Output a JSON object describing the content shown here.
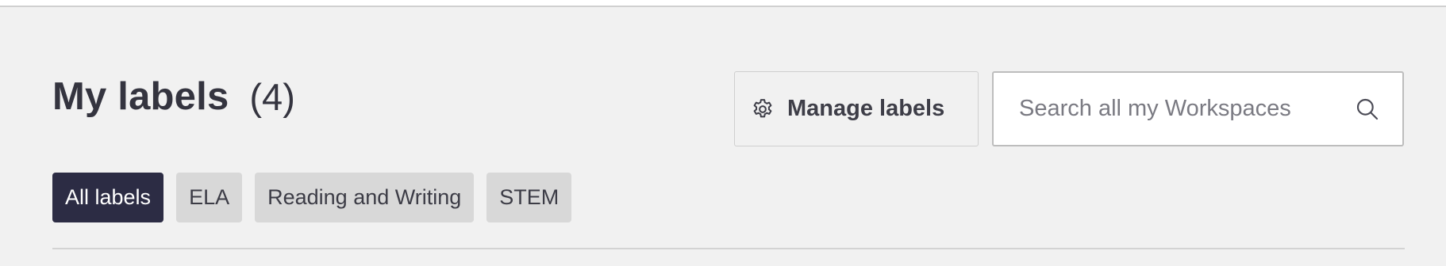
{
  "header": {
    "title": "My labels",
    "count": "(4)"
  },
  "toolbar": {
    "manage_label": "Manage labels",
    "manage_icon": "gear-icon"
  },
  "search": {
    "placeholder": "Search all my Workspaces",
    "value": "",
    "icon": "search-icon"
  },
  "filters": {
    "items": [
      {
        "label": "All labels",
        "active": true
      },
      {
        "label": "ELA",
        "active": false
      },
      {
        "label": "Reading and Writing",
        "active": false
      },
      {
        "label": "STEM",
        "active": false
      }
    ]
  },
  "colors": {
    "background": "#f1f1f1",
    "active_chip": "#2c2c44",
    "inactive_chip": "#d8d8d8",
    "text": "#34343f"
  }
}
